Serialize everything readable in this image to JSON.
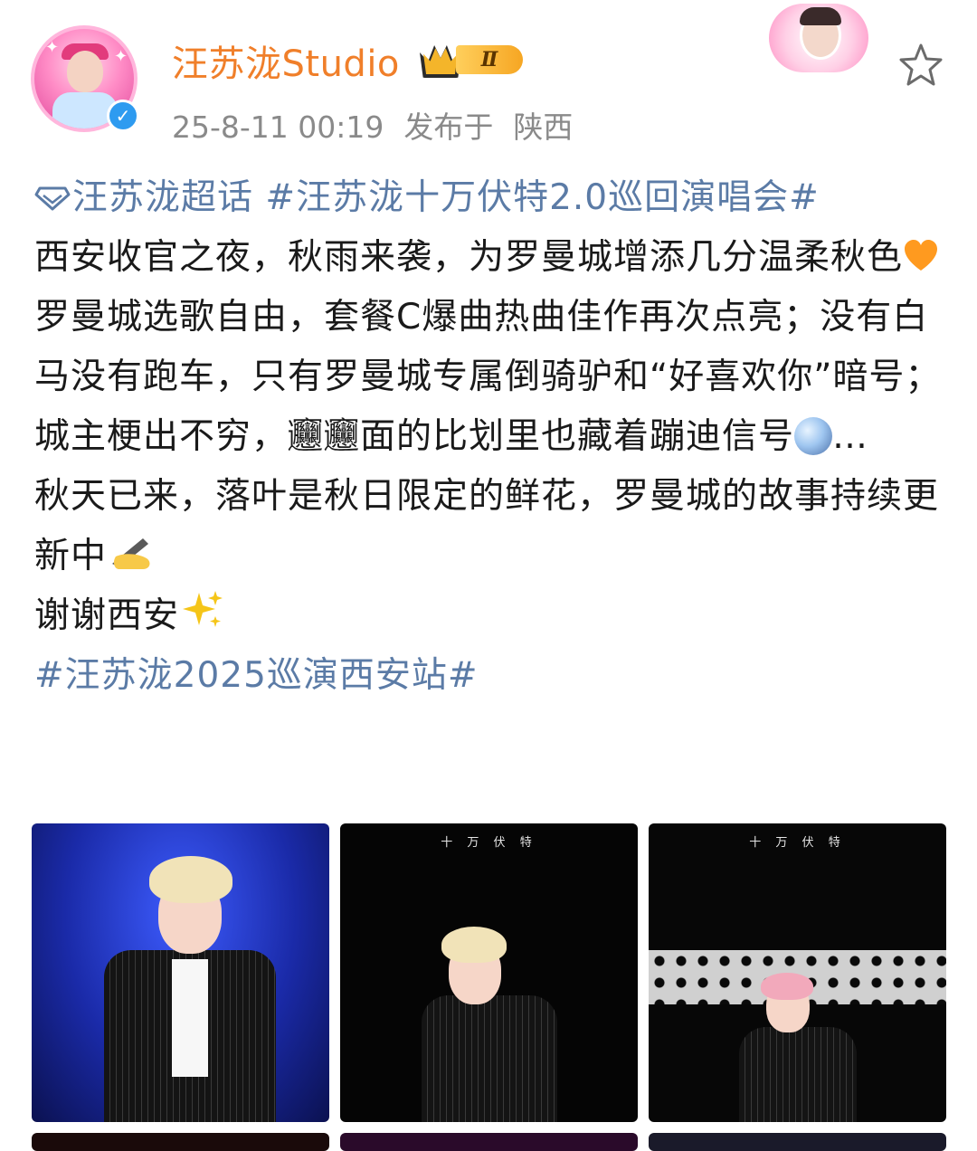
{
  "post": {
    "username": "汪苏泷Studio",
    "level_badge": "Ⅱ",
    "timestamp": "25-8-11 00:19",
    "location_prefix": "发布于",
    "location": "陕西",
    "verified_mark": "✓"
  },
  "content": {
    "supertopic": "汪苏泷超话",
    "hashtag1": "#汪苏泷十万伏特2.0巡回演唱会#",
    "line1": "西安收官之夜，秋雨来袭，为罗曼城增添几分温柔秋色",
    "line2": "罗曼城选歌自由，套餐C爆曲热曲佳作再次点亮；没有白马没有跑车，只有罗曼城专属倒骑驴和“好喜欢你”暗号；城主梗出不穷，𰻞𰻞面的比划里也藏着蹦迪信号",
    "line2_tail": "…",
    "line3": "秋天已来，落叶是秋日限定的鲜花，罗曼城的故事持续更新中",
    "line4": "谢谢西安",
    "hashtag2": "#汪苏泷2025巡演西安站#"
  },
  "photos": {
    "stage_text": "十 万 伏 特"
  },
  "colors": {
    "username": "#f07f2a",
    "link": "#5b7ba6",
    "meta": "#8a8a8a",
    "verified": "#2e9bf0"
  },
  "icons": {
    "favorite": "star-outline-icon",
    "topic": "diamond-topic-icon",
    "verified": "verified-check-icon",
    "level": "crown-icon"
  }
}
